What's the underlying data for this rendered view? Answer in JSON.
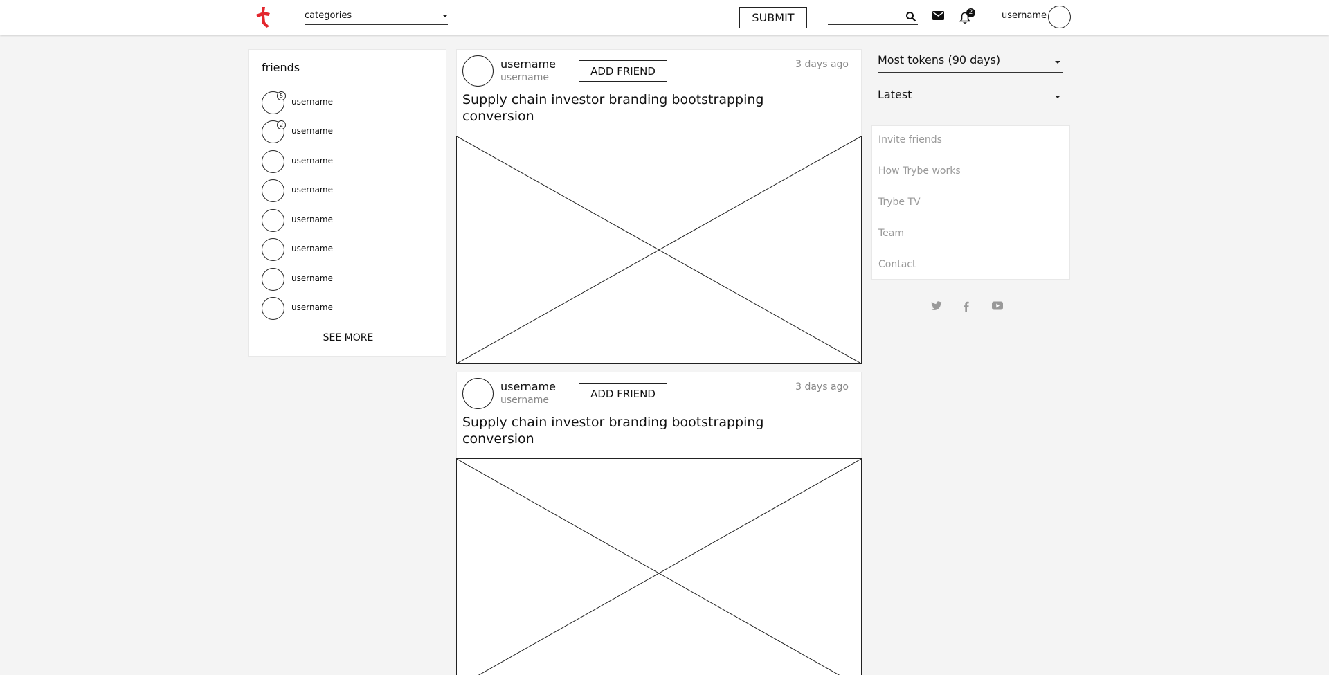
{
  "header": {
    "categories_label": "categories",
    "submit_label": "SUBMIT",
    "search_placeholder": "",
    "notifications_count": "2",
    "username": "username",
    "brand_color": "#e3262d"
  },
  "friends": {
    "title": "friends",
    "items": [
      {
        "name": "username",
        "badge": "5"
      },
      {
        "name": "username",
        "badge": "2"
      },
      {
        "name": "username",
        "badge": ""
      },
      {
        "name": "username",
        "badge": ""
      },
      {
        "name": "username",
        "badge": ""
      },
      {
        "name": "username",
        "badge": ""
      },
      {
        "name": "username",
        "badge": ""
      },
      {
        "name": "username",
        "badge": ""
      }
    ],
    "see_more_label": "SEE MORE"
  },
  "posts": [
    {
      "username": "username",
      "handle": "username",
      "add_friend_label": "ADD FRIEND",
      "time": "3 days ago",
      "title": "Supply chain investor branding bootstrapping conversion"
    },
    {
      "username": "username",
      "handle": "username",
      "add_friend_label": "ADD FRIEND",
      "time": "3 days ago",
      "title": "Supply chain investor branding bootstrapping conversion"
    }
  ],
  "sidebar": {
    "sort_primary": "Most tokens (90 days)",
    "sort_secondary": "Latest",
    "links": [
      "Invite friends",
      "How Trybe works",
      "Trybe TV",
      "Team",
      "Contact"
    ],
    "social_icons": [
      "twitter-icon",
      "facebook-icon",
      "youtube-icon"
    ]
  }
}
